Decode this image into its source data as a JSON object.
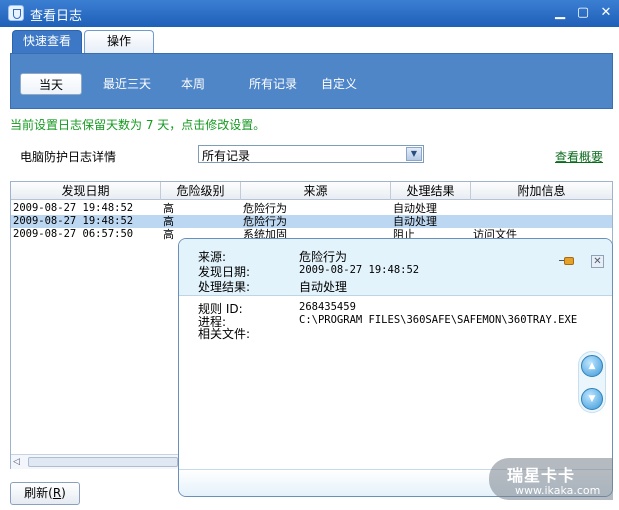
{
  "window": {
    "title": "查看日志",
    "controls": {
      "minimize": "▁",
      "maximize": "▢",
      "close": "✕"
    }
  },
  "tabs": [
    {
      "label": "快速查看",
      "active": true
    },
    {
      "label": "操作",
      "active": false
    }
  ],
  "filters": [
    {
      "label": "当天",
      "active": true
    },
    {
      "label": "最近三天",
      "active": false
    },
    {
      "label": "本周",
      "active": false
    },
    {
      "label": "所有记录",
      "active": false
    },
    {
      "label": "自定义",
      "active": false
    }
  ],
  "notice": "当前设置日志保留天数为 7 天，点击修改设置。",
  "detail_label": "电脑防护日志详情",
  "log_select": {
    "value": "所有记录",
    "arrow": "▼"
  },
  "summary_link": "查看概要",
  "table": {
    "columns": [
      "发现日期",
      "危险级别",
      "来源",
      "处理结果",
      "附加信息"
    ],
    "rows": [
      {
        "date": "2009-08-27 19:48:52",
        "level": "高",
        "source": "危险行为",
        "result": "自动处理",
        "extra": "",
        "selected": false
      },
      {
        "date": "2009-08-27 19:48:52",
        "level": "高",
        "source": "危险行为",
        "result": "自动处理",
        "extra": "",
        "selected": true
      },
      {
        "date": "2009-08-27 06:57:50",
        "level": "高",
        "source": "系统加固",
        "result": "阻止",
        "extra": "访问文件",
        "selected": false
      }
    ],
    "scroll_left": "◁"
  },
  "refresh_button": {
    "label": "刷新(",
    "hotkey": "R",
    "suffix": ")"
  },
  "popup": {
    "source_label": "来源:",
    "source_value": "危险行为",
    "date_label": "发现日期:",
    "date_value": "2009-08-27 19:48:52",
    "result_label": "处理结果:",
    "result_value": "自动处理",
    "rule_label": "规则 ID:",
    "rule_value": "268435459",
    "process_label": "进程:",
    "process_value": "C:\\PROGRAM FILES\\360SAFE\\SAFEMON\\360TRAY.EXE",
    "file_label": "相关文件:",
    "close": "✕",
    "up": "▲",
    "down": "▼"
  },
  "watermark": {
    "name": "瑞星卡卡",
    "url": "www.ikaka.com"
  },
  "colors": {
    "accent": "#4f86c8",
    "notice": "#159a20",
    "selected_row": "#bcd7f1"
  }
}
